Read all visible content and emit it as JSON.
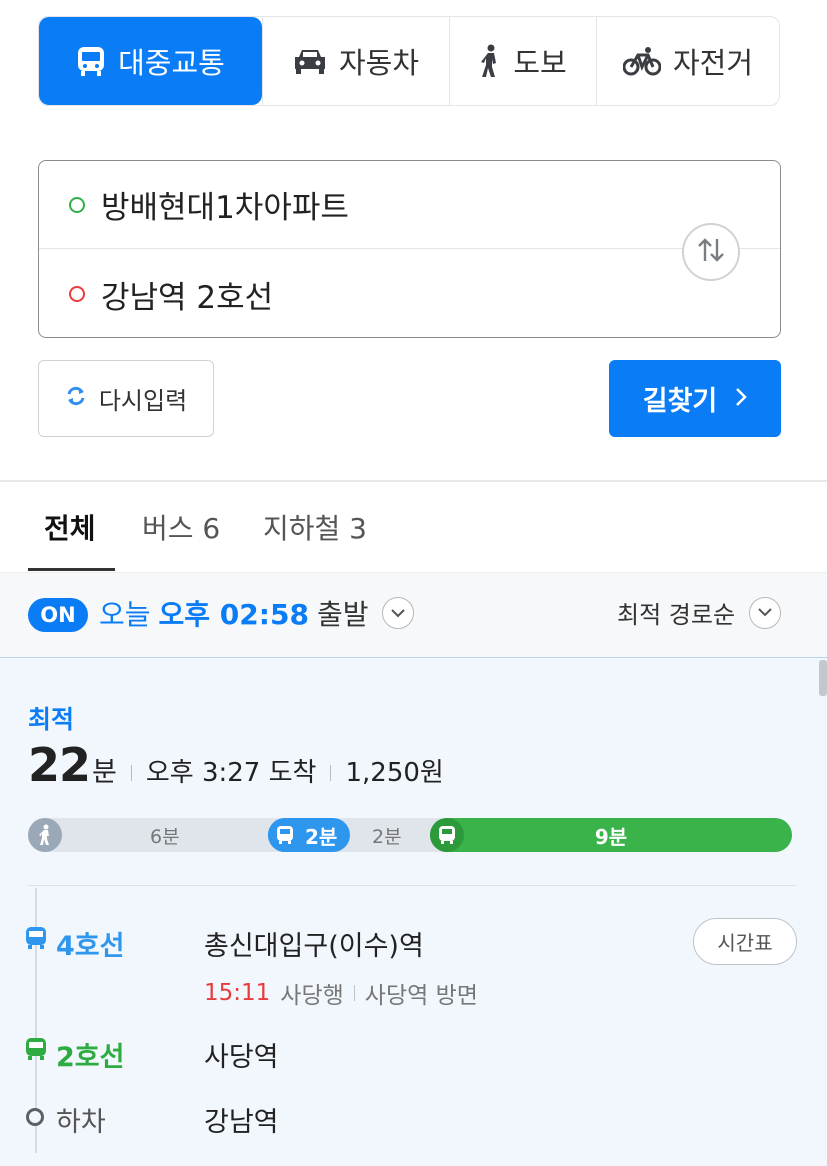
{
  "modes": [
    {
      "label": "대중교통",
      "icon": "bus-icon",
      "active": true
    },
    {
      "label": "자동차",
      "icon": "car-icon",
      "active": false
    },
    {
      "label": "도보",
      "icon": "walk-icon",
      "active": false
    },
    {
      "label": "자전거",
      "icon": "bicycle-icon",
      "active": false
    }
  ],
  "route": {
    "start": "방배현대1차아파트",
    "end": "강남역 2호선"
  },
  "buttons": {
    "reset": "다시입력",
    "search": "길찾기"
  },
  "result_tabs": [
    "전체",
    "버스 6",
    "지하철 3"
  ],
  "departure": {
    "badge": "ON",
    "day": "오늘",
    "time": "오후 02:58",
    "suffix": "출발",
    "sort": "최적 경로순"
  },
  "result": {
    "tag": "최적",
    "duration_value": "22",
    "duration_unit": "분",
    "arrival": "오후 3:27 도착",
    "fare": "1,250원",
    "timeline": {
      "walk": "6분",
      "bus": "2분",
      "transfer_walk": "2분",
      "subway": "9분",
      "colors": {
        "walk": "#9aa8b8",
        "bus": "#2f96ee",
        "subway": "#39b34a"
      }
    },
    "steps": [
      {
        "line": "4호선",
        "station": "총신대입구(이수)역"
      },
      {
        "line": "2호선",
        "station": "사당역"
      },
      {
        "line": "하차",
        "station": "강남역"
      }
    ],
    "detail": {
      "time": "15:11",
      "direction": "사당행",
      "platform": "사당역 방면"
    },
    "timetable": "시간표"
  }
}
